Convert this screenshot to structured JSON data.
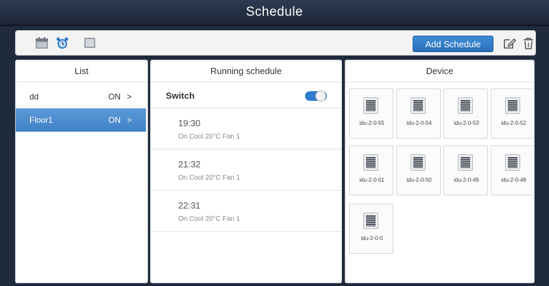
{
  "app": {
    "title": "Schedule"
  },
  "toolbar": {
    "icons": [
      "calendar-icon",
      "alarm-clock-icon",
      "list-view-icon",
      "edit-icon",
      "trash-icon"
    ],
    "add_label": "Add Schedule"
  },
  "list": {
    "header": "List",
    "items": [
      {
        "name": "dd",
        "status": "ON",
        "arrow": ">"
      },
      {
        "name": "Floor1",
        "status": "ON",
        "arrow": ">"
      }
    ]
  },
  "running": {
    "header": "Running schedule",
    "switch_label": "Switch",
    "switch_on": true,
    "entries": [
      {
        "time": "19:30",
        "desc": "On Cool 20°C Fan 1"
      },
      {
        "time": "21:32",
        "desc": "On Cool 20°C Fan 1"
      },
      {
        "time": "22:31",
        "desc": "On Cool 20°C Fan 1"
      }
    ]
  },
  "device": {
    "header": "Device",
    "items": [
      "idu-2-0-55",
      "idu-2-0-54",
      "idu-2-0-53",
      "idu-2-0-52",
      "idu-2-0-51",
      "idu-2-0-50",
      "idu-2-0-49",
      "idu-2-0-48",
      "idu-2-0-0"
    ]
  },
  "colors": {
    "accent": "#2a6fb8",
    "selected": "#4a8bcf",
    "title_bg": "#1f2a3d"
  }
}
